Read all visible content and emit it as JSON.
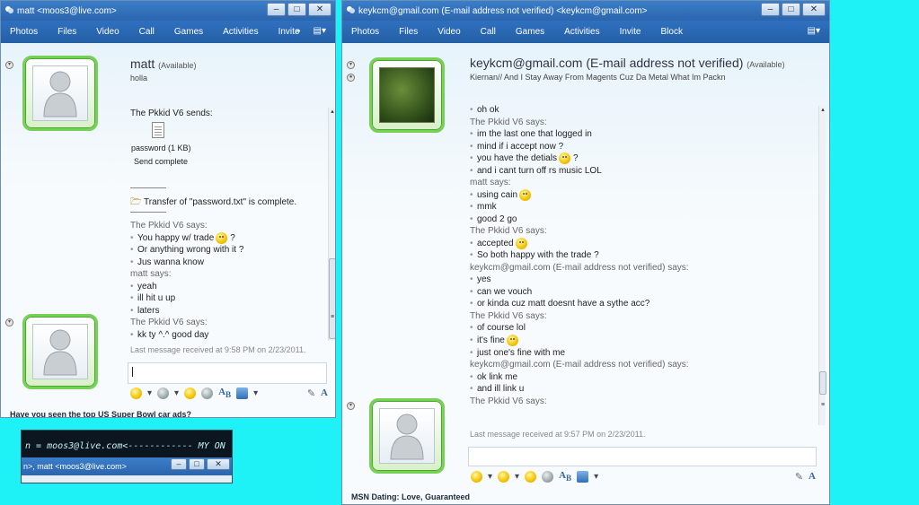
{
  "left": {
    "title": "matt <moos3@live.com>",
    "menu": [
      "Photos",
      "Files",
      "Video",
      "Call",
      "Games",
      "Activities",
      "Invite"
    ],
    "menu_more": "»",
    "contact_name": "matt",
    "contact_status": "(Available)",
    "contact_message": "holla",
    "transfer": {
      "sender_says": "The Pkkid V6 sends:",
      "file_label": "password (1 KB)",
      "file_status": "Send complete",
      "complete_msg": "Transfer of \"password.txt\" is complete."
    },
    "messages": [
      {
        "speaker": "The Pkkid V6 says:",
        "lines": [
          {
            "text": "You happy w/ trade",
            "emoticon": true,
            "suffix": "?"
          },
          {
            "text": "Or anything wrong with it ?"
          },
          {
            "text": "Jus wanna know"
          }
        ]
      },
      {
        "speaker": "matt says:",
        "lines": [
          {
            "text": "yeah"
          },
          {
            "text": "ill hit u up"
          },
          {
            "text": "laters"
          }
        ]
      },
      {
        "speaker": "The Pkkid V6 says:",
        "lines": [
          {
            "text": "kk ty ^.^ good day"
          }
        ]
      }
    ],
    "last_message": "Last message received at 9:58 PM on 2/23/2011.",
    "ad": "Have you seen the top US Super Bowl car ads?"
  },
  "right": {
    "title": "keykcm@gmail.com (E-mail address not verified) <keykcm@gmail.com>",
    "menu": [
      "Photos",
      "Files",
      "Video",
      "Call",
      "Games",
      "Activities",
      "Invite",
      "Block"
    ],
    "contact_name": "keykcm@gmail.com (E-mail address not verified)",
    "contact_status": "(Available)",
    "contact_message": "Kiernan// And I Stay Away From  Magents Cuz Da Metal What Im Packn",
    "messages": [
      {
        "speaker": "",
        "lines": [
          {
            "text": "oh ok"
          }
        ]
      },
      {
        "speaker": "The Pkkid V6 says:",
        "lines": [
          {
            "text": "im the last one that logged in"
          },
          {
            "text": "mind if i accept now ?"
          },
          {
            "text": "you have the detials",
            "emoticon": true,
            "suffix": "?"
          },
          {
            "text": "and i cant turn off rs music LOL"
          }
        ]
      },
      {
        "speaker": "matt says:",
        "lines": [
          {
            "text": "using cain",
            "emoticon": true
          },
          {
            "text": "mmk"
          },
          {
            "text": "good 2 go"
          }
        ]
      },
      {
        "speaker": "The Pkkid V6 says:",
        "lines": [
          {
            "text": "accepted",
            "emoticon": true
          },
          {
            "text": "So both happy with the trade ?"
          }
        ]
      },
      {
        "speaker": "keykcm@gmail.com (E-mail address not verified) says:",
        "lines": [
          {
            "text": "yes"
          },
          {
            "text": "can we vouch"
          },
          {
            "text": "or kinda cuz matt doesnt have a sythe acc?"
          }
        ]
      },
      {
        "speaker": "The Pkkid V6 says:",
        "lines": [
          {
            "text": "of course lol"
          },
          {
            "text": "it's fine",
            "emoticon": true
          },
          {
            "text": "just one's fine with me"
          }
        ]
      },
      {
        "speaker": "keykcm@gmail.com (E-mail address not verified) says:",
        "lines": [
          {
            "text": "ok link me"
          },
          {
            "text": "and ill link u"
          }
        ]
      },
      {
        "speaker": "The Pkkid V6 says:",
        "lines": []
      }
    ],
    "last_message": "Last message received at 9:57 PM on 2/23/2011.",
    "ad": "MSN Dating: Love, Guaranteed"
  },
  "mini": {
    "text": "n = moos3@live.com<------------ MY ON",
    "title": "n>, matt <moos3@live.com>"
  },
  "controls": {
    "min": "–",
    "max": "□",
    "close": "✕"
  }
}
